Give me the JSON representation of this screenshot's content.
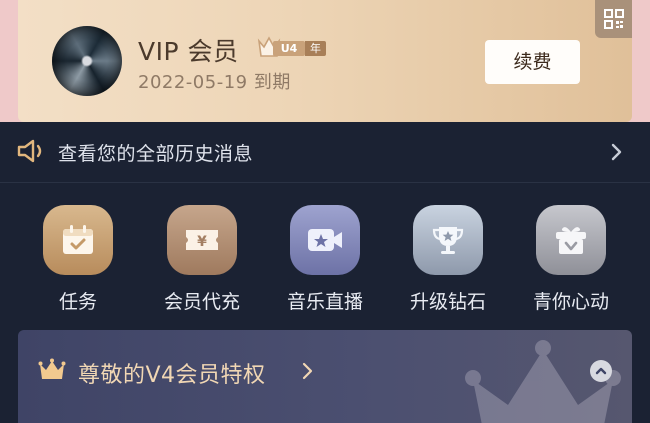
{
  "vip": {
    "title": "VIP 会员",
    "level": "U4",
    "level_suffix": "年",
    "expire": "2022-05-19 到期",
    "renew_label": "续费"
  },
  "notice": {
    "text": "查看您的全部历史消息"
  },
  "grid": [
    {
      "label": "任务",
      "icon": "calendar-check-icon",
      "color": "#c59a68"
    },
    {
      "label": "会员代充",
      "icon": "yen-ticket-icon",
      "color": "#b48d72"
    },
    {
      "label": "音乐直播",
      "icon": "video-star-icon",
      "color": "#7a7fb0"
    },
    {
      "label": "升级钻石",
      "icon": "trophy-star-icon",
      "color": "#a6b1c2"
    },
    {
      "label": "青你心动",
      "icon": "gift-box-icon",
      "color": "#a9aab1"
    }
  ],
  "privilege": {
    "title": "尊敬的V4会员特权"
  }
}
